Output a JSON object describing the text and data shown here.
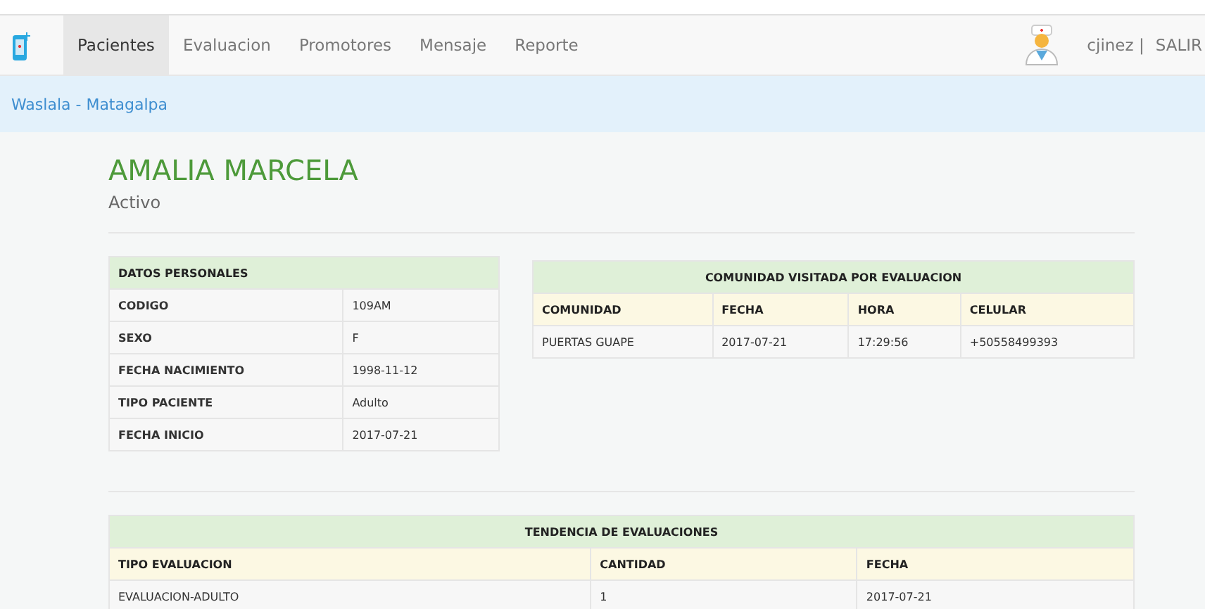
{
  "nav": {
    "tabs": [
      {
        "label": "Pacientes",
        "selected": true
      },
      {
        "label": "Evaluacion",
        "selected": false
      },
      {
        "label": "Promotores",
        "selected": false
      },
      {
        "label": "Mensaje",
        "selected": false
      },
      {
        "label": "Reporte",
        "selected": false
      }
    ],
    "user": "cjinez |",
    "logout": "SALIR"
  },
  "breadcrumb": "Waslala - Matagalpa",
  "patient": {
    "name": "AMALIA MARCELA",
    "status": "Activo"
  },
  "personal": {
    "title": "DATOS PERSONALES",
    "rows": [
      {
        "label": "CODIGO",
        "value": "109AM"
      },
      {
        "label": "SEXO",
        "value": "F"
      },
      {
        "label": "FECHA NACIMIENTO",
        "value": "1998-11-12"
      },
      {
        "label": "TIPO PACIENTE",
        "value": "Adulto"
      },
      {
        "label": "FECHA INICIO",
        "value": "2017-07-21"
      }
    ]
  },
  "community": {
    "title": "COMUNIDAD VISITADA POR EVALUACION",
    "columns": [
      "COMUNIDAD",
      "FECHA",
      "HORA",
      "CELULAR"
    ],
    "rows": [
      [
        "PUERTAS GUAPE",
        "2017-07-21",
        "17:29:56",
        "+50558499393"
      ]
    ]
  },
  "trend": {
    "title": "TENDENCIA DE EVALUACIONES",
    "columns": [
      "TIPO EVALUACION",
      "CANTIDAD",
      "FECHA"
    ],
    "rows": [
      [
        "EVALUACION-ADULTO",
        "1",
        "2017-07-21"
      ]
    ]
  }
}
